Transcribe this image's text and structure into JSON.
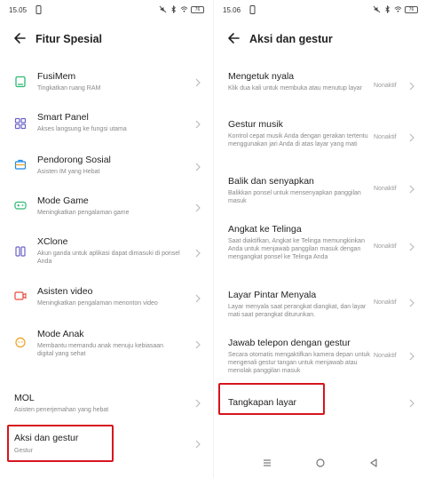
{
  "left": {
    "status": {
      "time": "15.05",
      "battery": "76"
    },
    "title": "Fitur Spesial",
    "items": [
      {
        "label": "FusiMem",
        "sub": "Tingkatkan ruang RAM",
        "icon": "memory-icon"
      },
      {
        "label": "Smart Panel",
        "sub": "Akses langsung ke fungsi utama",
        "icon": "grid-icon"
      },
      {
        "label": "Pendorong Sosial",
        "sub": "Asisten IM yang Hebat",
        "icon": "briefcase-icon"
      },
      {
        "label": "Mode Game",
        "sub": "Meningkatkan pengalaman game",
        "icon": "gamepad-icon"
      },
      {
        "label": "XClone",
        "sub": "Akun ganda untuk aplikasi dapat dimasuki di ponsel Anda",
        "icon": "clone-icon"
      },
      {
        "label": "Asisten video",
        "sub": "Meningkatkan pengalaman menonton video",
        "icon": "video-icon"
      },
      {
        "label": "Mode Anak",
        "sub": "Membantu memandu anak menuju kebiasaan digital yang sehat",
        "icon": "child-icon"
      },
      {
        "label": "MOL",
        "sub": "Asisten penerjemahan yang hebat"
      },
      {
        "label": "Aksi dan gestur",
        "sub": "Gestur"
      }
    ]
  },
  "right": {
    "status": {
      "time": "15.06",
      "battery": "76"
    },
    "title": "Aksi dan gestur",
    "items": [
      {
        "label": "Mengetuk nyala",
        "sub": "Klik dua kali untuk membuka atau menutup layar",
        "state": "Nonaktif"
      },
      {
        "label": "Gestur musik",
        "sub": "Kontrol cepat musik Anda dengan gerakan tertentu menggunakan jari Anda di atas layar yang mati",
        "state": "Nonaktif"
      },
      {
        "label": "Balik dan senyapkan",
        "sub": "Balikkan ponsel untuk mensenyapkan panggilan masuk",
        "state": "Nonaktif"
      },
      {
        "label": "Angkat ke Telinga",
        "sub": "Saat diaktifkan, Angkat ke Telinga memungkinkan Anda untuk menjawab panggilan masuk dengan mengangkat ponsel ke Telinga Anda",
        "state": "Nonaktif"
      },
      {
        "label": "Layar Pintar Menyala",
        "sub": "Layar menyala saat perangkat diangkat, dan layar mati saat perangkat diturunkan.",
        "state": "Nonaktif"
      },
      {
        "label": "Jawab telepon dengan gestur",
        "sub": "Secara otomatis mengaktifkan kamera depan untuk mengenali gestur tangan untuk menjawab atau menolak panggilan masuk",
        "state": "Nonaktif"
      },
      {
        "label": "Tangkapan layar"
      }
    ]
  },
  "colors": {
    "accent_green": "#2fb872",
    "accent_purple": "#6b63c8",
    "highlight_red": "#d8141e"
  }
}
